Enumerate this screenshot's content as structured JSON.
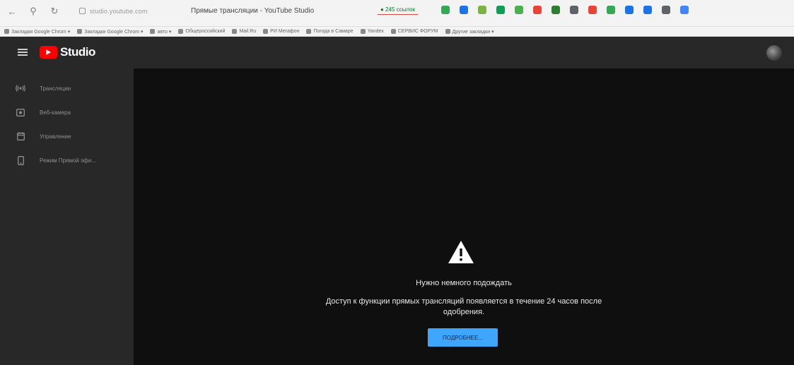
{
  "browser": {
    "url": "studio.youtube.com",
    "page_title": "Прямые трансляции - YouTube Studio",
    "tab_badge": "● 245 ссылок",
    "bookmarks": [
      "Закладки Google Chrom ▾",
      "Закладки Google Chrom ▾",
      "авто ▾",
      "Общероссийский",
      "Mail.Ru",
      "РИ Мегафон",
      "Погода в Самаре",
      "Yandex",
      "СЕРВИС ФОРУМ",
      "Другие закладки ▾"
    ],
    "extension_colors": [
      "#34a853",
      "#1a73e8",
      "#7cb342",
      "#0f9d58",
      "#4caf50",
      "#ea4335",
      "#2e7d32",
      "#5f6368",
      "#ea4335",
      "#34a853",
      "#1a73e8",
      "#1a73e8",
      "#5f6368",
      "#4285f4"
    ]
  },
  "app": {
    "logo_text": "Studio",
    "sidebar": [
      {
        "label": "Трансляции",
        "icon": "live-icon"
      },
      {
        "label": "Веб-камера",
        "icon": "webcam-icon"
      },
      {
        "label": "Управление",
        "icon": "calendar-icon"
      },
      {
        "label": "Режим Прямой эфи...",
        "icon": "phone-icon"
      }
    ],
    "message": {
      "title": "Нужно немного подождать",
      "body": "Доступ к функции прямых трансляций появляется в течение 24 часов после одобрения.",
      "button": "ПОДРОБНЕЕ..."
    }
  },
  "colors": {
    "accent": "#3ea6ff",
    "brand_red": "#ff0000",
    "content_bg": "#0f0f0f",
    "sidebar_bg": "#282828"
  }
}
